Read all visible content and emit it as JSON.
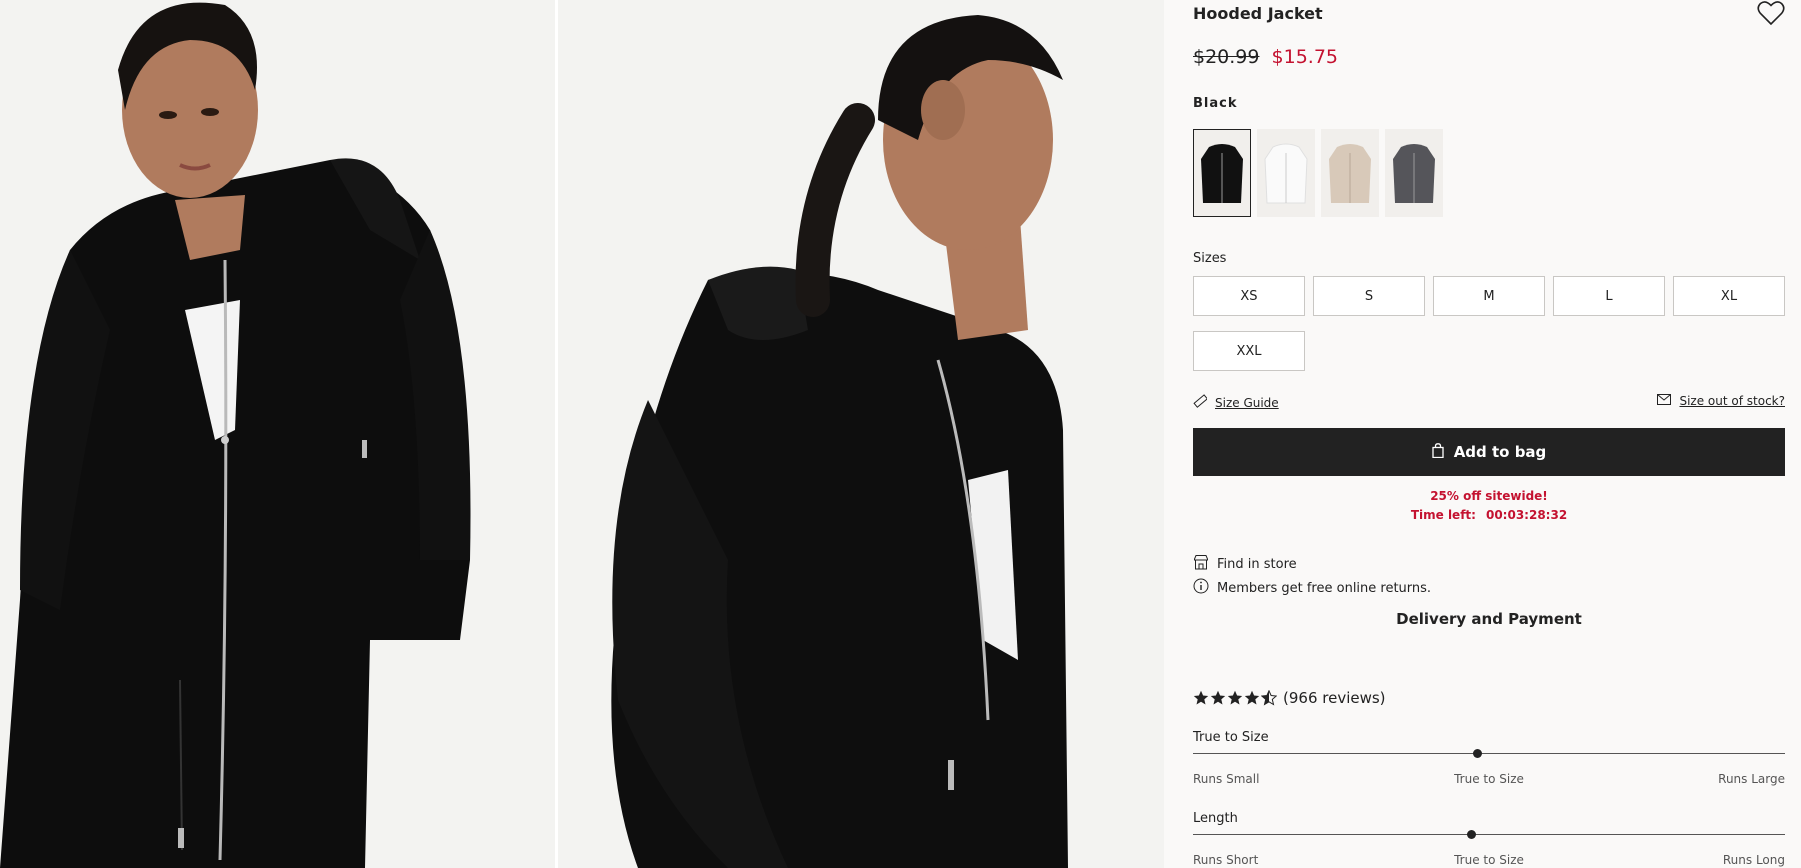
{
  "product": {
    "title": "Hooded Jacket",
    "price_old": "$20.99",
    "price_new": "$15.75",
    "color_name": "Black"
  },
  "swatches": [
    {
      "name": "Black",
      "color": "#111111",
      "selected": true
    },
    {
      "name": "White",
      "color": "#f6f6f6",
      "selected": false
    },
    {
      "name": "Beige",
      "color": "#d8c9b9",
      "selected": false
    },
    {
      "name": "Dark grey",
      "color": "#55555a",
      "selected": false
    }
  ],
  "sizes": {
    "label": "Sizes",
    "options": [
      "XS",
      "S",
      "M",
      "L",
      "XL",
      "XXL"
    ]
  },
  "links": {
    "size_guide": "Size Guide",
    "size_out_of_stock": "Size out of stock?"
  },
  "cta": {
    "add_to_bag": "Add to bag"
  },
  "promo": {
    "line1": "25% off sitewide!",
    "time_label": "Time left:",
    "time_value": "00:03:28:32"
  },
  "info": {
    "find_in_store": "Find in store",
    "returns": "Members get free online returns.",
    "delivery": "Delivery and Payment"
  },
  "reviews": {
    "rating": 4.5,
    "text": "(966 reviews)"
  },
  "fit": [
    {
      "title": "True to Size",
      "left": "Runs Small",
      "center": "True to Size",
      "right": "Runs Large",
      "value": 0.48
    },
    {
      "title": "Length",
      "left": "Runs Short",
      "center": "True to Size",
      "right": "Runs Long",
      "value": 0.47
    }
  ],
  "colors": {
    "sale_red": "#c41230",
    "button_dark": "#222222"
  }
}
